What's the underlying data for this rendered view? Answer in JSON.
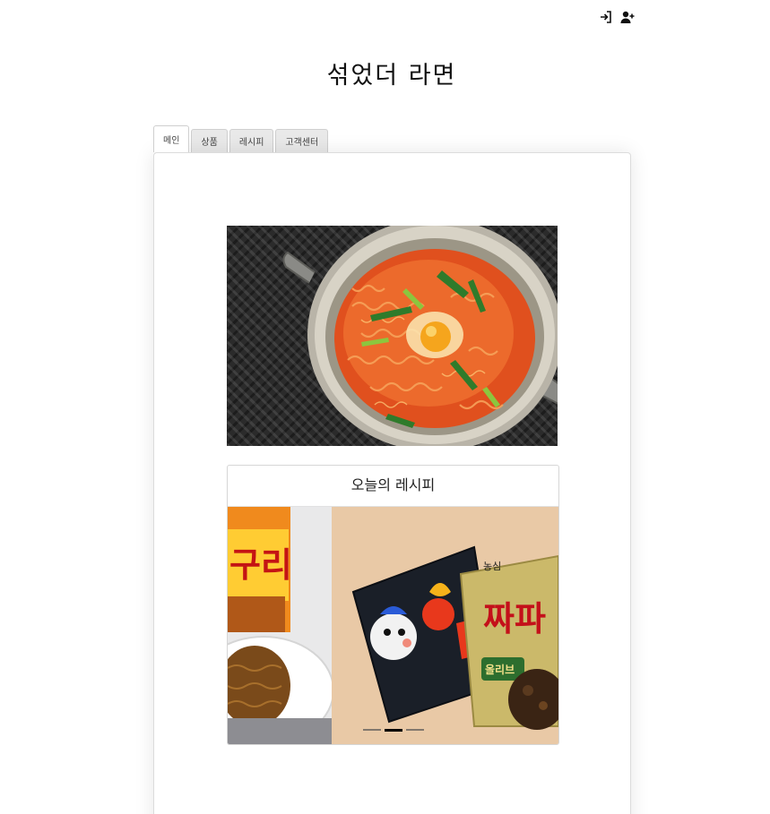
{
  "header": {
    "title": "섞었더 라면",
    "icons": [
      "login-icon",
      "user-plus-icon"
    ]
  },
  "tabs": [
    {
      "label": "메인",
      "active": true
    },
    {
      "label": "상품",
      "active": false
    },
    {
      "label": "레시피",
      "active": false
    },
    {
      "label": "고객센터",
      "active": false
    }
  ],
  "main": {
    "hero_image": "ramen-pot-photo",
    "recipe_card": {
      "title": "오늘의 레시피",
      "carousel": {
        "slide_count": 3,
        "active_index": 1,
        "left_package_text": "구리",
        "right_package_text": "짜파",
        "right_package_brand": "농심",
        "right_package_badge": "올리브"
      }
    }
  }
}
